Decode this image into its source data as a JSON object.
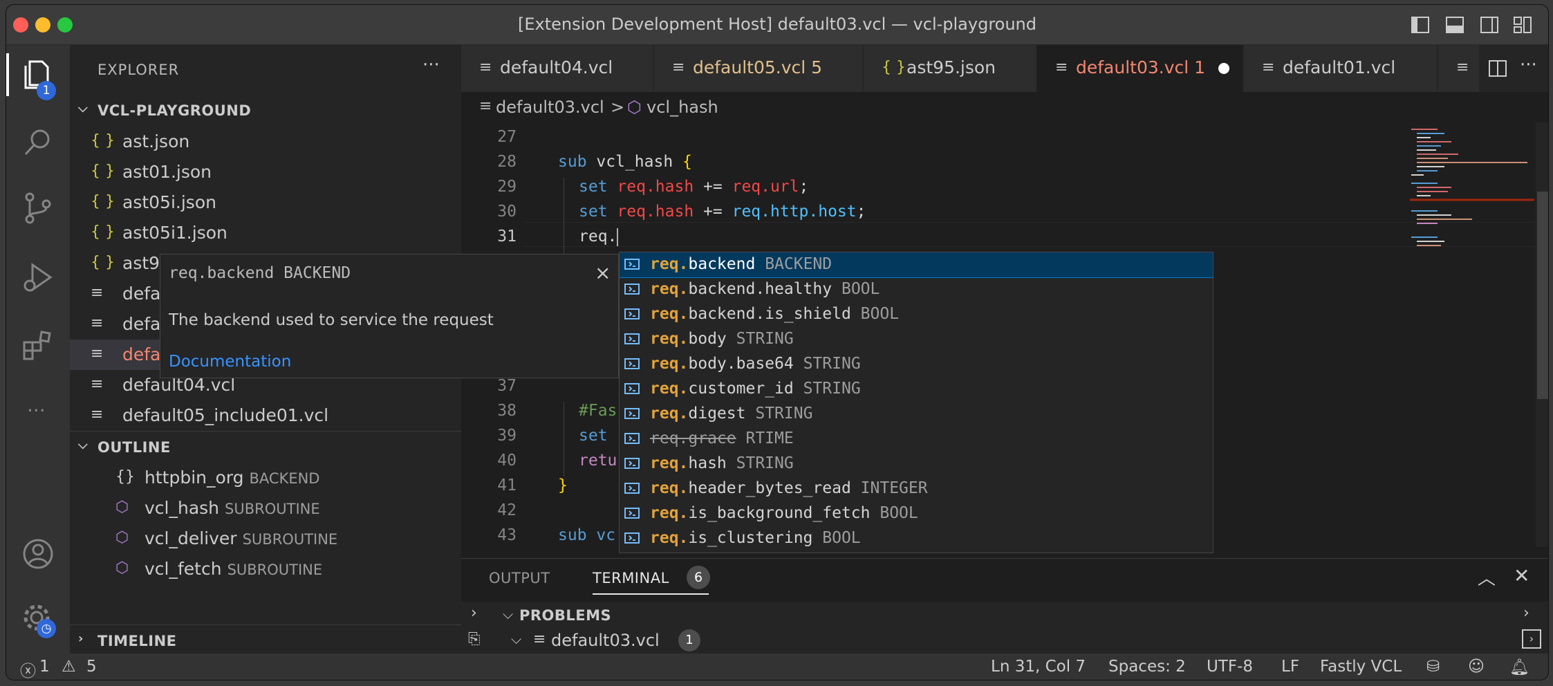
{
  "window": {
    "title": "[Extension Development Host] default03.vcl — vcl-playground"
  },
  "activity": {
    "explorer_badge": "1"
  },
  "sidebar": {
    "header": "EXPLORER",
    "more": "···",
    "project": "VCL-PLAYGROUND",
    "files": [
      {
        "icon": "{ }",
        "name": "ast.json"
      },
      {
        "icon": "{ }",
        "name": "ast01.json"
      },
      {
        "icon": "{ }",
        "name": "ast05i.json"
      },
      {
        "icon": "{ }",
        "name": "ast05i1.json"
      },
      {
        "icon": "{ }",
        "name": "ast9"
      },
      {
        "icon": "≡",
        "name": "defa"
      },
      {
        "icon": "≡",
        "name": "defa"
      },
      {
        "icon": "≡",
        "name": "defa"
      },
      {
        "icon": "≡",
        "name": "default04.vcl"
      },
      {
        "icon": "≡",
        "name": "default05_include01.vcl"
      }
    ],
    "outline_label": "OUTLINE",
    "outline": [
      {
        "name": "httpbin_org",
        "kind": "BACKEND"
      },
      {
        "name": "vcl_hash",
        "kind": "SUBROUTINE"
      },
      {
        "name": "vcl_deliver",
        "kind": "SUBROUTINE"
      },
      {
        "name": "vcl_fetch",
        "kind": "SUBROUTINE"
      }
    ],
    "timeline_label": "TIMELINE"
  },
  "tabs": [
    {
      "name": "default04.vcl",
      "suffix": ""
    },
    {
      "name": "default05.vcl",
      "suffix": "5"
    },
    {
      "name": "ast95.json",
      "suffix": ""
    },
    {
      "name": "default03.vcl",
      "suffix": "1"
    },
    {
      "name": "default01.vcl",
      "suffix": ""
    }
  ],
  "breadcrumb": {
    "file": "default03.vcl",
    "sep": ">",
    "symbol": "vcl_hash"
  },
  "editor": {
    "line_numbers": [
      "27",
      "28",
      "29",
      "30",
      "31",
      "37",
      "38",
      "39",
      "40",
      "41",
      "42",
      "43"
    ],
    "lines": {
      "l28": [
        "sub",
        "vcl_hash",
        "{"
      ],
      "l29": [
        "set",
        "req.hash",
        "+=",
        "req.url",
        ";"
      ],
      "l30": [
        "set",
        "req.hash",
        "+=",
        "req.http.host",
        ";"
      ],
      "l31": "req.",
      "l38": "#Fas",
      "l39": "set",
      "l40": "retu",
      "l41": "}",
      "l43": "sub vc"
    }
  },
  "docs": {
    "title": "req.backend BACKEND",
    "close": "×",
    "description": "The backend used to service the request",
    "link": "Documentation"
  },
  "suggest": {
    "prefix": "req.",
    "items": [
      {
        "rest": "backend",
        "type": "BACKEND"
      },
      {
        "rest": "backend.healthy",
        "type": "BOOL"
      },
      {
        "rest": "backend.is_shield",
        "type": "BOOL"
      },
      {
        "rest": "body",
        "type": "STRING"
      },
      {
        "rest": "body.base64",
        "type": "STRING"
      },
      {
        "rest": "customer_id",
        "type": "STRING"
      },
      {
        "rest": "digest",
        "type": "STRING"
      },
      {
        "rest": "req.grace",
        "type": "RTIME"
      },
      {
        "rest": "hash",
        "type": "STRING"
      },
      {
        "rest": "header_bytes_read",
        "type": "INTEGER"
      },
      {
        "rest": "is_background_fetch",
        "type": "BOOL"
      },
      {
        "rest": "is_clustering",
        "type": "BOOL"
      }
    ]
  },
  "panel": {
    "output": "OUTPUT",
    "terminal": "TERMINAL",
    "terminal_badge": "6",
    "problems": "PROBLEMS",
    "problem_file": "default03.vcl",
    "problem_count": "1"
  },
  "status": {
    "errors": "1",
    "warnings": "5",
    "position": "Ln 31, Col 7",
    "spaces": "Spaces: 2",
    "encoding": "UTF-8",
    "eol": "LF",
    "language": "Fastly VCL"
  },
  "colors": {
    "accent": "#007acc",
    "modified": "#e2c08d",
    "error_tab": "#f48771"
  }
}
